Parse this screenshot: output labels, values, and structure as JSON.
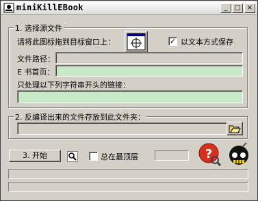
{
  "window": {
    "title": "miniKillEBook"
  },
  "titlebar_buttons": {
    "minimize": "_",
    "maximize": "□",
    "close": "×"
  },
  "section1": {
    "legend": "1. 选择源文件",
    "drag_hint": "请将此图标拖到目标窗口上：",
    "save_as_text_label": "以文本方式保存",
    "save_as_text_checked": true,
    "file_path_label": "文件路径：",
    "file_path_value": "",
    "ebook_home_label": "E 书首页：",
    "ebook_home_value": "",
    "link_filter_label": "只处理以下列字符串开头的链接：",
    "link_filter_value": ""
  },
  "section2": {
    "legend": "2. 反编译出来的文件存放到此文件夹：",
    "folder_value": ""
  },
  "start_button_label": "3. 开始",
  "always_on_top_label": "总在最顶层",
  "always_on_top_checked": false,
  "status_lines": [
    "",
    ""
  ]
}
